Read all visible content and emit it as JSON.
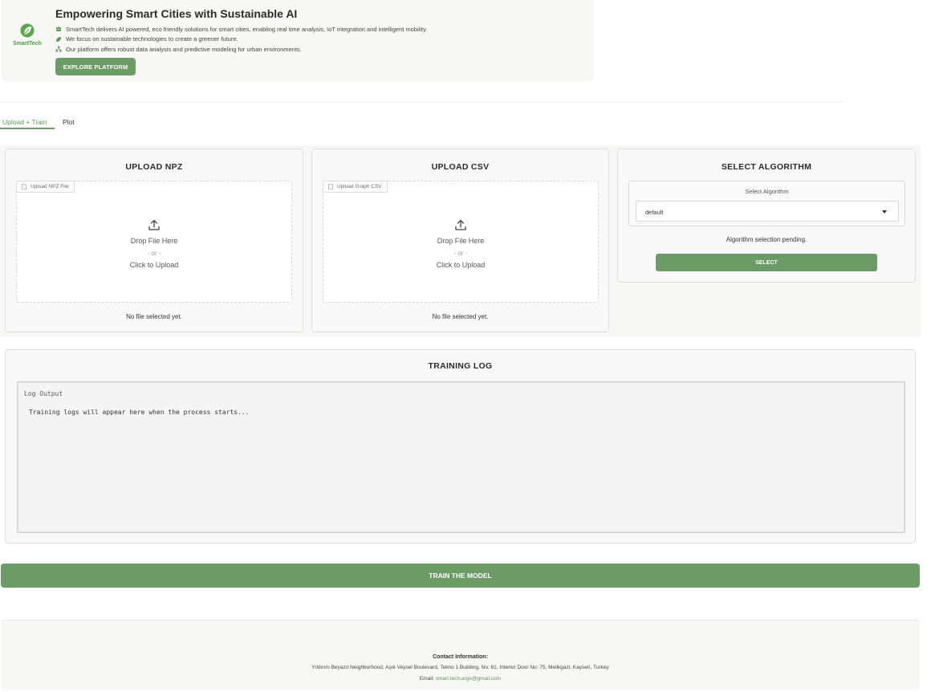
{
  "hero": {
    "logo_text": "SmartTech",
    "title": "Empowering Smart Cities with Sustainable AI",
    "items": [
      {
        "icon": "robot-icon",
        "text": "SmartTech delivers AI powered, eco friendly solutions for smart cities, enabling real time analysis, IoT integration and intelligent mobility."
      },
      {
        "icon": "leaf-icon",
        "text": "We focus on sustainable technologies to create a greener future."
      },
      {
        "icon": "network-icon",
        "text": "Our platform offers robust data analysis and predictive modeling for urban environments."
      }
    ],
    "cta_label": "EXPLORE PLATFORM",
    "accent": "#6c9c66"
  },
  "tabs": [
    {
      "label": "Upload + Train",
      "active": true
    },
    {
      "label": "Plot",
      "active": false
    }
  ],
  "upload_npz": {
    "title": "UPLOAD NPZ",
    "field_label": "Upload NPZ File",
    "drop_text": "Drop File Here",
    "or_text": "- or -",
    "click_text": "Click to Upload",
    "status": "No file selected yet."
  },
  "upload_csv": {
    "title": "UPLOAD CSV",
    "field_label": "Upload Graph CSV",
    "drop_text": "Drop File Here",
    "or_text": "- or -",
    "click_text": "Click to Upload",
    "status": "No file selected yet."
  },
  "algorithm": {
    "title": "SELECT ALGORITHM",
    "dropdown_label": "Select Algorithm",
    "selected": "default",
    "status": "Algorithm selection pending.",
    "button_label": "SELECT"
  },
  "training_log": {
    "title": "TRAINING LOG",
    "label": "Log Output",
    "text": "Training logs will appear here when the process starts..."
  },
  "train_button": "TRAIN THE MODEL",
  "footer": {
    "heading": "Contact Information:",
    "address": "Yıldırım Beyazıt Neighborhood, Aşık Veysel Boulevard, Tekno 1 Building, No: 61, Interior Door No: 75, Melikgazi, Kayseri, Turkey",
    "email_label": "Email:",
    "email": "smart.tech.arge@gmail.com"
  }
}
